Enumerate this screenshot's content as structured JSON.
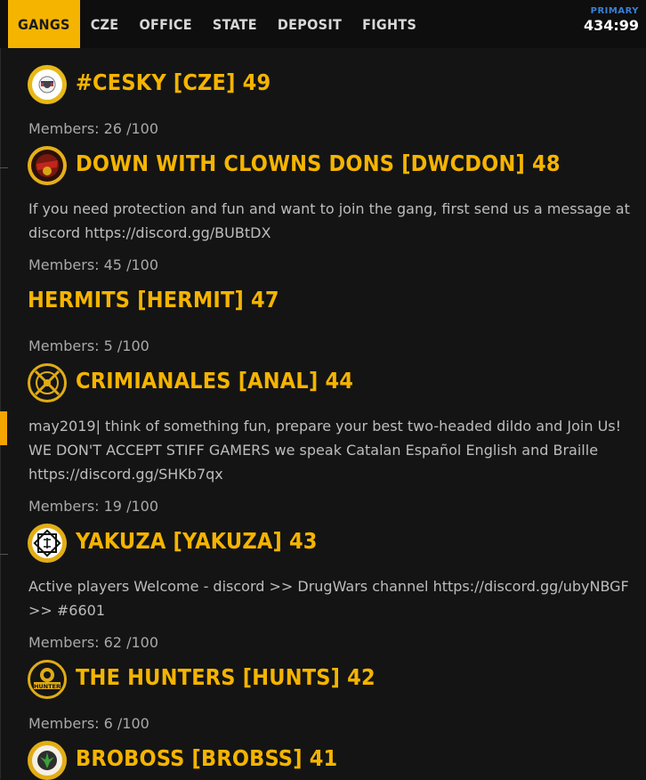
{
  "nav": {
    "tabs": [
      {
        "label": "GANGS",
        "active": true
      },
      {
        "label": "CZE"
      },
      {
        "label": "OFFICE"
      },
      {
        "label": "STATE"
      },
      {
        "label": "DEPOSIT"
      },
      {
        "label": "FIGHTS"
      }
    ]
  },
  "clock": {
    "label": "PRIMARY",
    "value": "434:99"
  },
  "colors": {
    "accent": "#f5b400",
    "background": "#141414",
    "clock_label": "#3a7fd6"
  },
  "gangs": [
    {
      "name": "#CESKY [CZE] 49",
      "description": "",
      "members": "Members: 26 /100",
      "emblem": "cesky-emblem-icon"
    },
    {
      "name": "DOWN WITH CLOWNS DONS [DWCDON] 48",
      "description": "If you need protection and fun and want to join the gang, first send us a message at discord https://discord.gg/BUBtDX",
      "members": "Members: 45 /100",
      "emblem": "dwcdon-emblem-icon"
    },
    {
      "name": "HERMITS [HERMIT] 47",
      "description": "",
      "members": "Members: 5 /100",
      "emblem": ""
    },
    {
      "name": "CRIMIANALES [ANAL] 44",
      "description": "may2019| think of something fun, prepare your best two-headed dildo and Join Us! WE DON'T ACCEPT STIFF GAMERS we speak Catalan Español English and Braille https://discord.gg/SHKb7qx",
      "members": "Members: 19 /100",
      "emblem": "anal-emblem-icon"
    },
    {
      "name": "YAKUZA [YAKUZA] 43",
      "description": "Active players Welcome - discord >> DrugWars channel https://discord.gg/ubyNBGF >> #6601",
      "members": "Members: 62 /100",
      "emblem": "yakuza-emblem-icon"
    },
    {
      "name": "THE HUNTERS [HUNTS] 42",
      "description": "",
      "members": "Members: 6 /100",
      "emblem": "hunter-emblem-icon",
      "emblem_text": "HUNTER"
    },
    {
      "name": "BROBOSS [BROBSS] 41",
      "description": "",
      "members": "",
      "emblem": "broboss-emblem-icon"
    }
  ]
}
